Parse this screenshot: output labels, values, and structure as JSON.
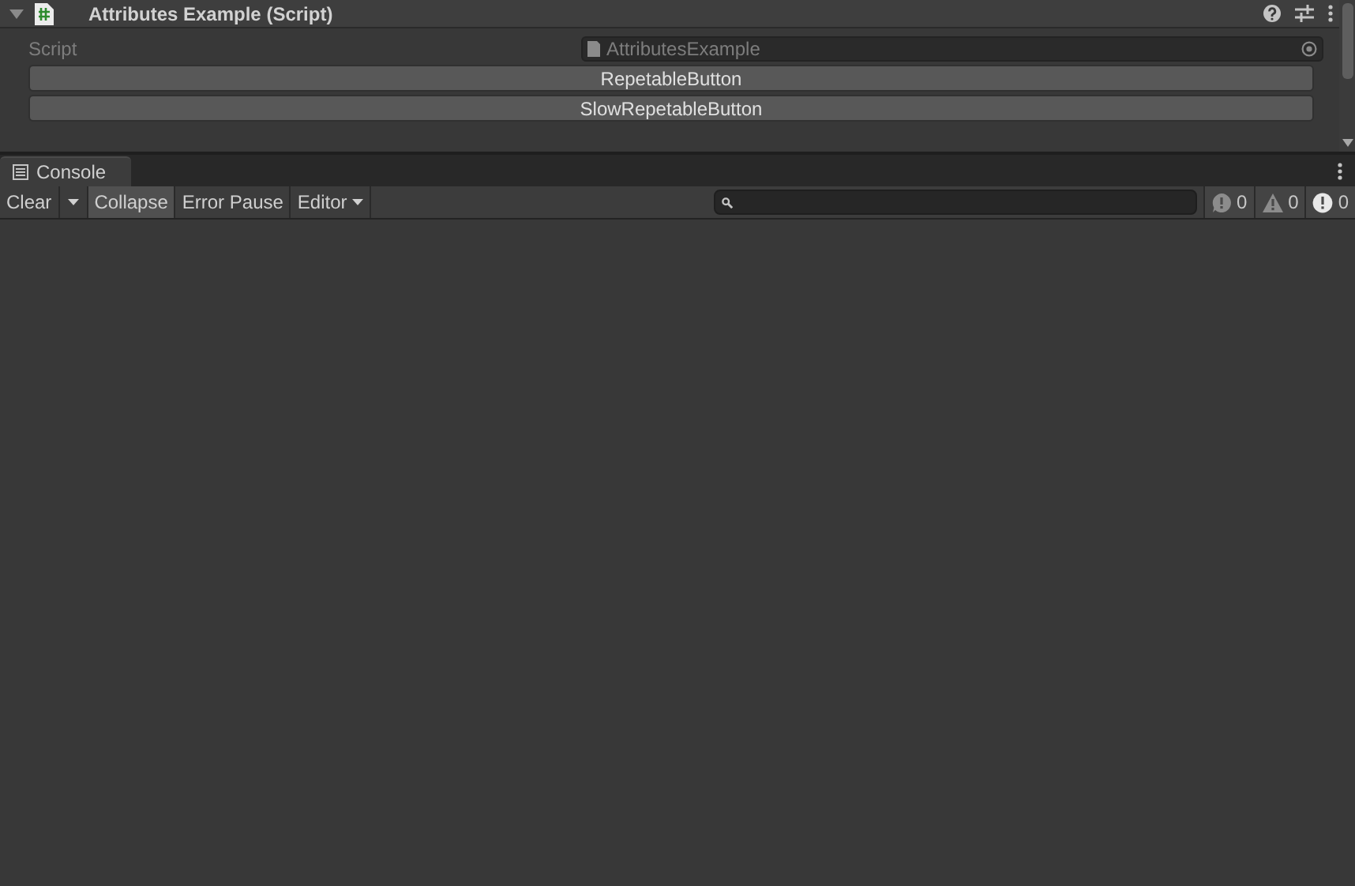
{
  "component": {
    "title": "Attributes Example (Script)",
    "expanded": true,
    "script_field": {
      "label": "Script",
      "value": "AttributesExample"
    },
    "buttons": [
      "RepetableButton",
      "SlowRepetableButton"
    ]
  },
  "console": {
    "tab": {
      "label": "Console",
      "selected": true
    },
    "toolbar": [
      {
        "kind": "toggle",
        "label": "Clear",
        "on": false
      },
      {
        "kind": "dropdown-caret",
        "on": false
      },
      {
        "kind": "toggle",
        "label": "Collapse",
        "on": true
      },
      {
        "kind": "toggle",
        "label": "Error Pause",
        "on": false
      },
      {
        "kind": "dropdown",
        "label": "Editor",
        "on": false
      }
    ],
    "counters": [
      {
        "kind": "info",
        "count": "0"
      },
      {
        "kind": "warning",
        "count": "0"
      },
      {
        "kind": "error",
        "count": "0"
      }
    ]
  }
}
